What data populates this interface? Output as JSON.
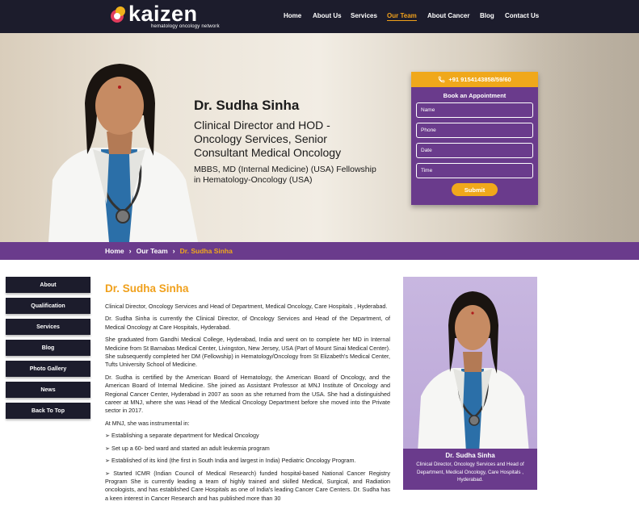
{
  "brand": {
    "name": "kaizen",
    "tagline": "hematology oncology network"
  },
  "nav": {
    "items": [
      {
        "label": "Home"
      },
      {
        "label": "About Us"
      },
      {
        "label": "Services"
      },
      {
        "label": "Our Team",
        "active": true
      },
      {
        "label": "About Cancer"
      },
      {
        "label": "Blog"
      },
      {
        "label": "Contact Us"
      }
    ]
  },
  "hero": {
    "name": "Dr. Sudha Sinha",
    "title_lines": [
      "Clinical Director and HOD -",
      "Oncology Services, Senior",
      "Consultant Medical Oncology"
    ],
    "quals_lines": [
      "MBBS, MD (Internal Medicine) (USA) Fellowship",
      "in Hematology-Oncology (USA)"
    ]
  },
  "appointment": {
    "phone": "+91 9154143858/59/60",
    "title": "Book an Appointment",
    "fields": {
      "name": "Name",
      "phone": "Phone",
      "date": "Date",
      "time": "Time"
    },
    "submit": "Submit"
  },
  "breadcrumb": {
    "items": [
      "Home",
      "Our Team"
    ],
    "current": "Dr. Sudha Sinha"
  },
  "side_menu": [
    "About",
    "Qualification",
    "Services",
    "Blog",
    "Photo Gallery",
    "News",
    "Back To Top"
  ],
  "main": {
    "heading": "Dr. Sudha Sinha",
    "paragraphs": [
      "Clinical Director, Oncology Services and Head of Department, Medical Oncology, Care Hospitals , Hyderabad.",
      "Dr. Sudha Sinha is currently the Clinical Director, of Oncology Services and Head of the Department, of Medical Oncology at Care Hospitals, Hyderabad.",
      "She graduated from Gandhi Medical College, Hyderabad, India and went on to complete her MD in Internal Medicine from St Barnabas Medical Center, Livingston, New Jersey, USA (Part of Mount Sinai Medical Center). She subsequently completed her DM (Fellowship) in Hematology/Oncology from St Elizabeth's Medical Center, Tufts University School of Medicine.",
      "Dr. Sudha is certified by the American Board of Hematology, the American Board of Oncology, and the American Board of Internal Medicine. She joined as Assistant Professor at MNJ Institute of Oncology and Regional Cancer Center, Hyderabad in 2007 as soon as she returned from the USA. She had a distinguished career at MNJ, where she was Head of the Medical Oncology Department before she moved into the Private sector in 2017.",
      "At MNJ, she was instrumental in:",
      "➢ Establishing a separate department for Medical Oncology",
      "➢ Set up a 60- bed ward and started an adult leukemia program",
      "➢ Established of its kind (the first in South India and largest in India) Pediatric Oncology Program.",
      "➢ Started ICMR (Indian Council of Medical Research) funded hospital-based National Cancer Registry Program She is currently leading a team of highly trained and skilled Medical, Surgical, and Radiation oncologists, and has established Care Hospitals as one of India's leading Cancer Care Centers. Dr. Sudha has a keen interest in Cancer Research and has published more than 30"
    ]
  },
  "card": {
    "name": "Dr. Sudha Sinha",
    "role": "Clinical Director, Oncology Services and Head of Department, Medical Oncology, Care Hospitals , Hyderabad."
  },
  "colors": {
    "navbar": "#1c1c2c",
    "purple": "#6a3b8c",
    "accent": "#f0a81b"
  }
}
